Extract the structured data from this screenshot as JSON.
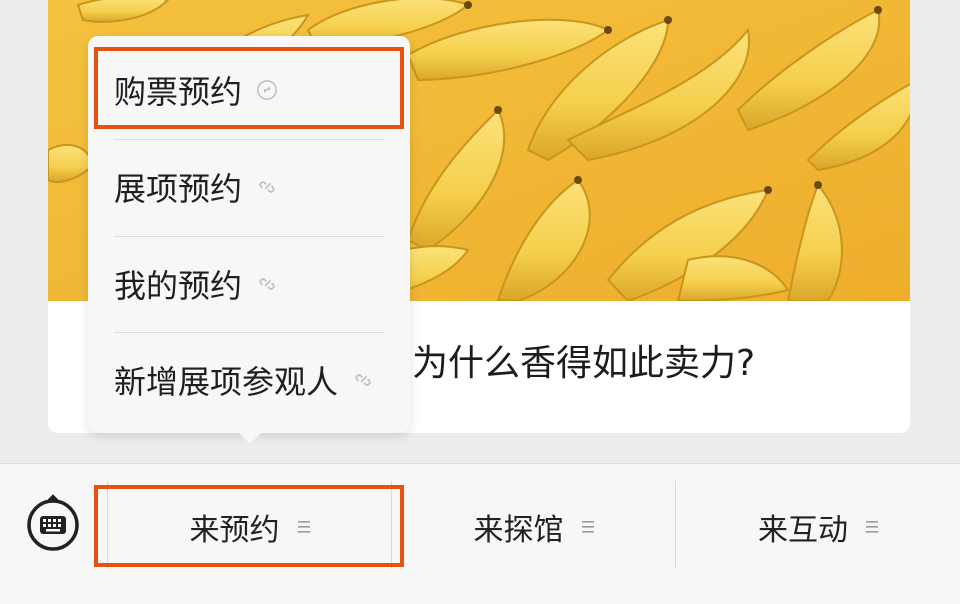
{
  "article": {
    "title": "为什么香得如此卖力?",
    "image_icon": "banana-photo"
  },
  "dropdown": {
    "items": [
      {
        "label": "购票预约",
        "icon": "link-icon",
        "highlighted": true
      },
      {
        "label": "展项预约",
        "icon": "link-icon",
        "highlighted": false
      },
      {
        "label": "我的预约",
        "icon": "link-icon",
        "highlighted": false
      },
      {
        "label": "新增展项参观人",
        "icon": "link-icon",
        "highlighted": false
      }
    ]
  },
  "bottom_bar": {
    "keyboard_icon": "keyboard-icon",
    "tabs": [
      {
        "label": "来预约",
        "icon": "menu-lines-icon",
        "highlighted": true
      },
      {
        "label": "来探馆",
        "icon": "menu-lines-icon",
        "highlighted": false
      },
      {
        "label": "来互动",
        "icon": "menu-lines-icon",
        "highlighted": false
      }
    ]
  },
  "colors": {
    "highlight": "#e8520f",
    "banana_background": "#f1b834",
    "menu_background": "#f7f7f7"
  }
}
